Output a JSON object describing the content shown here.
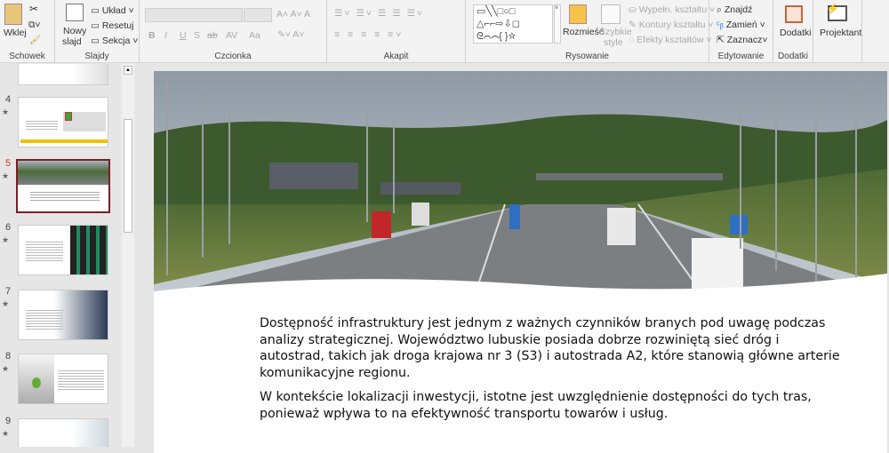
{
  "ribbon": {
    "clipboard": {
      "paste": "Wklej",
      "group": "Schowek"
    },
    "slides": {
      "new_slide_1": "Nowy",
      "new_slide_2": "slajd",
      "layout": "Układ",
      "reset": "Resetuj",
      "section": "Sekcja",
      "group": "Slajdy"
    },
    "font": {
      "group": "Czcionka",
      "bold": "B",
      "italic": "I",
      "underline": "U",
      "shadow": "S",
      "strike": "ab",
      "spacing": "AV",
      "case": "Aa"
    },
    "paragraph": {
      "group": "Akapit"
    },
    "drawing": {
      "arrange": "Rozmieść",
      "quick_styles_1": "Szybkie",
      "quick_styles_2": "style",
      "fill": "Wypełn. kształtu",
      "outline": "Kontury kształtu",
      "effects": "Efekty kształtów",
      "group": "Rysowanie"
    },
    "editing": {
      "find": "Znajdź",
      "replace": "Zamień",
      "select": "Zaznacz",
      "group": "Edytowanie"
    },
    "addins": {
      "label": "Dodatki",
      "group": "Dodatki"
    },
    "designer": {
      "label": "Projektant"
    }
  },
  "thumbnails": [
    {
      "num": "4"
    },
    {
      "num": "5",
      "selected": true
    },
    {
      "num": "6"
    },
    {
      "num": "7"
    },
    {
      "num": "8"
    },
    {
      "num": "9"
    }
  ],
  "slide": {
    "paragraphs": [
      "Dostępność infrastruktury jest jednym z ważnych czynników branych pod uwagę podczas analizy strategicznej. Województwo lubuskie posiada dobrze rozwiniętą sieć dróg i autostrad, takich jak droga krajowa nr 3 (S3) i autostrada A2, które stanowią główne arterie komunikacyjne regionu.",
      "W kontekście lokalizacji inwestycji, istotne jest uwzględnienie dostępności do tych tras, ponieważ wpływa to na efektywność transportu towarów i usług."
    ]
  },
  "colors": {
    "selected": "#7a1f24",
    "active_num": "#c43e1c"
  }
}
